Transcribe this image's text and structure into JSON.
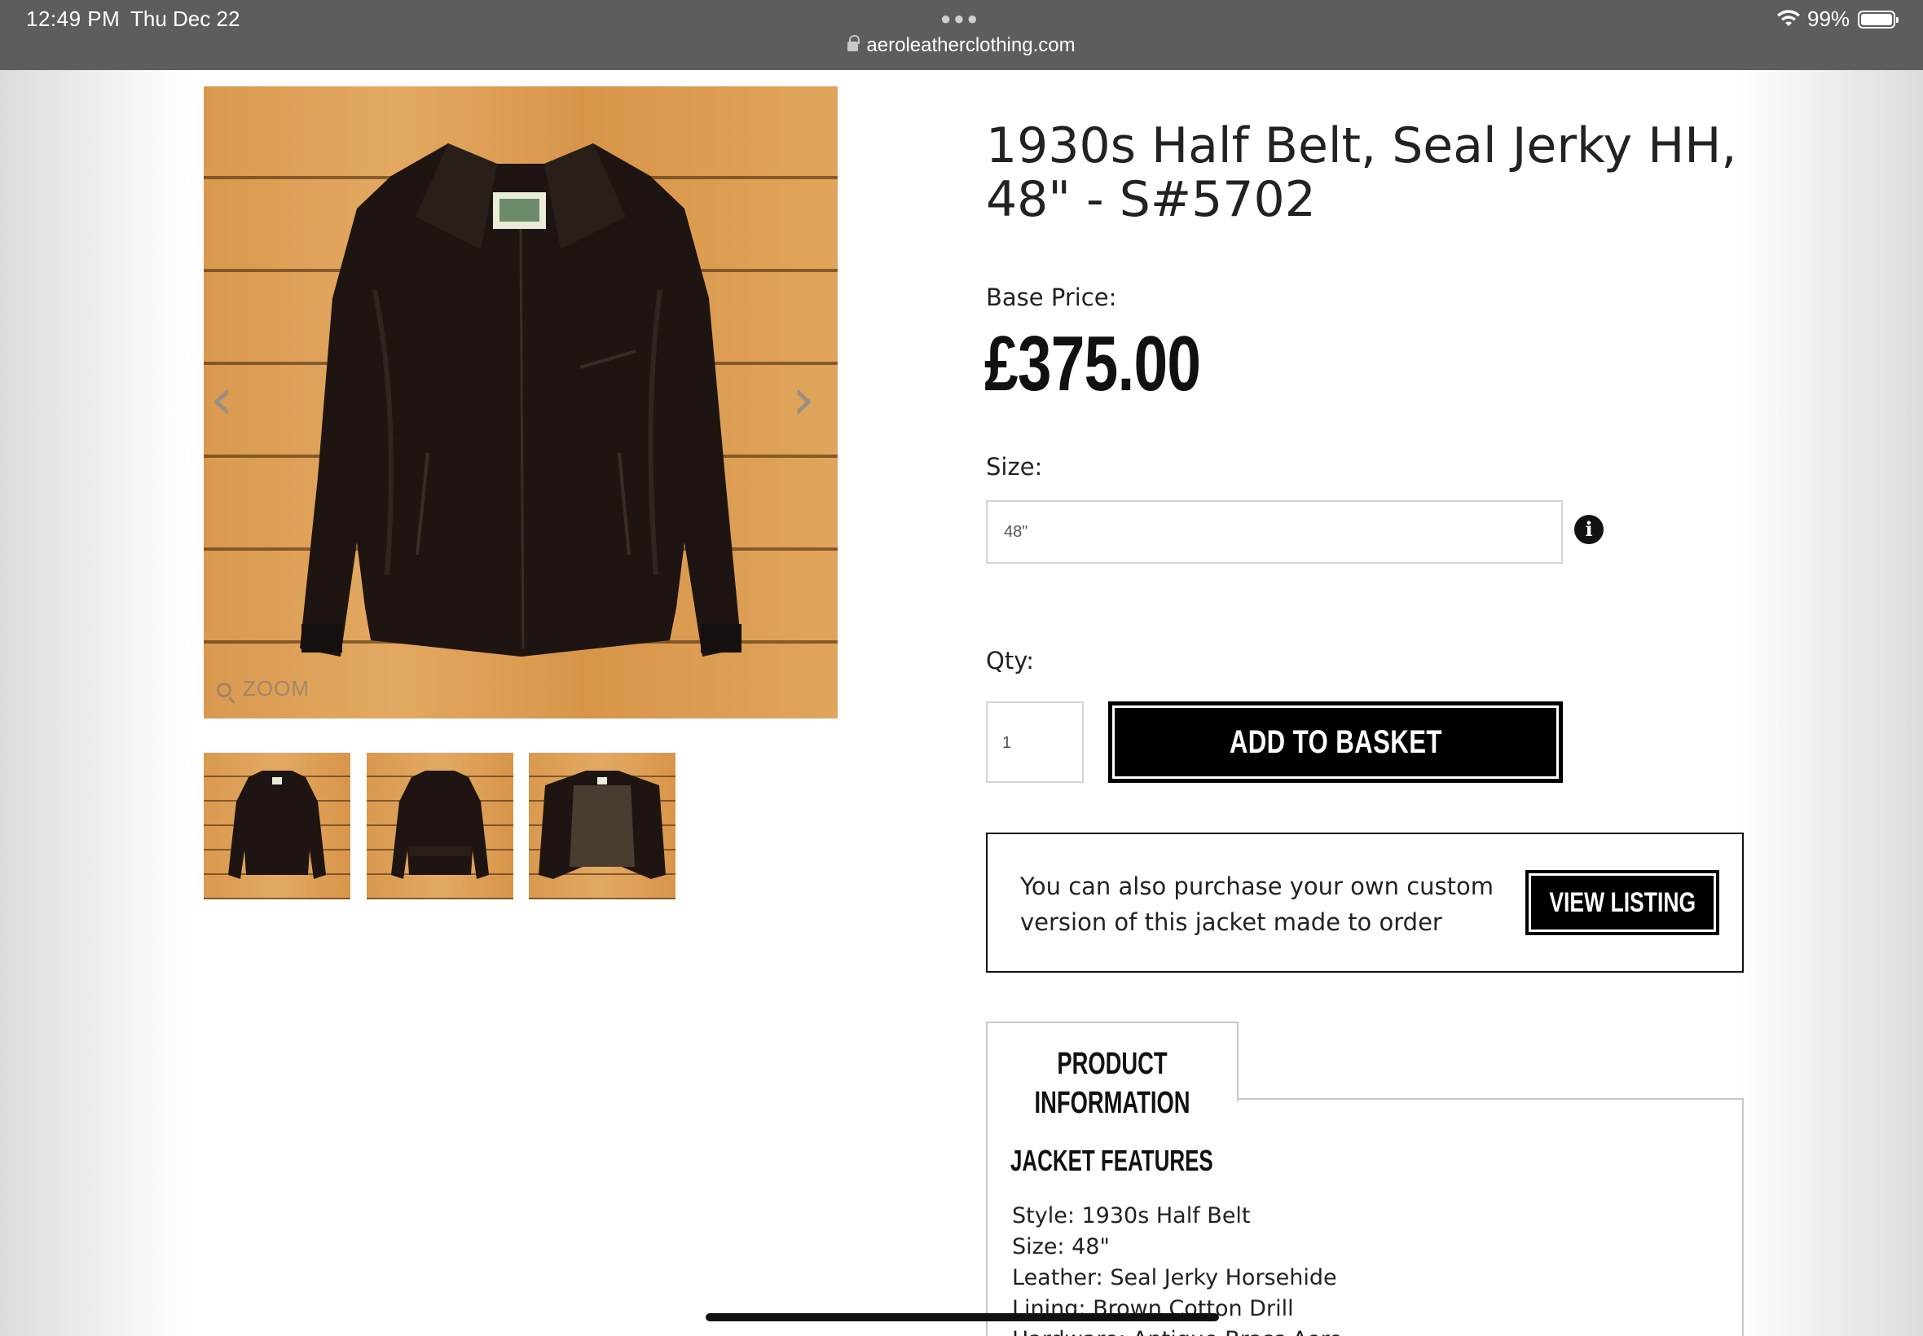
{
  "status_bar": {
    "time": "12:49 PM",
    "date": "Thu Dec 22",
    "url": "aeroleatherclothing.com",
    "battery": "99%"
  },
  "gallery": {
    "zoom_label": "ZOOM",
    "prev_icon": "chevron-left-icon",
    "next_icon": "chevron-right-icon",
    "thumbnails": [
      "front",
      "back",
      "inside"
    ]
  },
  "product": {
    "title": "1930s Half Belt, Seal Jerky HH, 48\" - S#5702",
    "base_price_label": "Base Price:",
    "price": "£375.00",
    "size_label": "Size:",
    "size_value": "48\"",
    "qty_label": "Qty:",
    "qty_value": "1",
    "add_to_basket": "ADD TO BASKET"
  },
  "custom_order": {
    "text": "You can also purchase your own custom version of this jacket made to order",
    "button": "VIEW LISTING"
  },
  "tabs": {
    "active": "PRODUCT INFORMATION"
  },
  "features": {
    "heading": "JACKET FEATURES",
    "items": [
      "Style: 1930s Half Belt",
      "Size: 48\"",
      "Leather: Seal Jerky Horsehide",
      "Lining: Brown Cotton Drill",
      "Hardware: Antique Brass Aero"
    ]
  },
  "colors": {
    "status_bar": "#5d5d5d",
    "button": "#000000",
    "wood": "#dd9f56",
    "leather": "#1e1512"
  }
}
